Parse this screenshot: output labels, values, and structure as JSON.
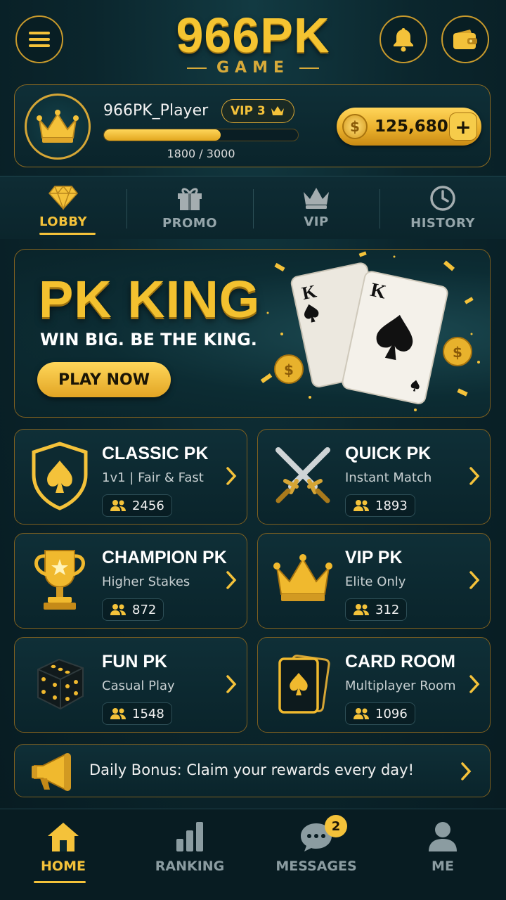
{
  "header": {
    "title": "966PK",
    "subtitle": "GAME",
    "menu_icon": "hamburger-menu-icon",
    "bell_icon": "bell-icon",
    "wallet_icon": "wallet-icon"
  },
  "player": {
    "name": "966PK_Player",
    "vip_label": "VIP 3",
    "xp_current": 1800,
    "xp_max": 3000,
    "xp_text": "1800 / 3000",
    "xp_progress_fraction": 0.6,
    "coins": "125,680",
    "coin_symbol": "$",
    "add_symbol": "+"
  },
  "tabs": [
    {
      "label": "LOBBY",
      "icon": "diamond-icon",
      "active": true
    },
    {
      "label": "PROMO",
      "icon": "gift-icon",
      "active": false
    },
    {
      "label": "VIP",
      "icon": "crown-icon",
      "active": false
    },
    {
      "label": "HISTORY",
      "icon": "clock-icon",
      "active": false
    }
  ],
  "banner": {
    "title": "PK KING",
    "subtitle": "WIN BIG. BE THE KING.",
    "button": "PLAY NOW",
    "card_rank": "K"
  },
  "games": [
    {
      "title": "CLASSIC PK",
      "subtitle": "1v1 | Fair & Fast",
      "players": "2456",
      "icon": "spade-shield-icon"
    },
    {
      "title": "QUICK PK",
      "subtitle": "Instant Match",
      "players": "1893",
      "icon": "crossed-swords-icon"
    },
    {
      "title": "CHAMPION PK",
      "subtitle": "Higher Stakes",
      "players": "872",
      "icon": "trophy-icon"
    },
    {
      "title": "VIP PK",
      "subtitle": "Elite Only",
      "players": "312",
      "icon": "crown-icon"
    },
    {
      "title": "FUN PK",
      "subtitle": "Casual Play",
      "players": "1548",
      "icon": "dice-icon"
    },
    {
      "title": "CARD ROOM",
      "subtitle": "Multiplayer Room",
      "players": "1096",
      "icon": "cards-icon"
    }
  ],
  "daily_bonus": {
    "text": "Daily Bonus: Claim your rewards every day!",
    "icon": "megaphone-icon"
  },
  "bottom_nav": [
    {
      "label": "HOME",
      "icon": "home-icon",
      "active": true
    },
    {
      "label": "RANKING",
      "icon": "bar-chart-icon",
      "active": false
    },
    {
      "label": "MESSAGES",
      "icon": "chat-icon",
      "active": false,
      "badge": "2"
    },
    {
      "label": "ME",
      "icon": "user-icon",
      "active": false
    }
  ],
  "colors": {
    "accent_gold": "#f4c23a",
    "background": "#0b262d",
    "inactive": "#8b9ca1"
  }
}
